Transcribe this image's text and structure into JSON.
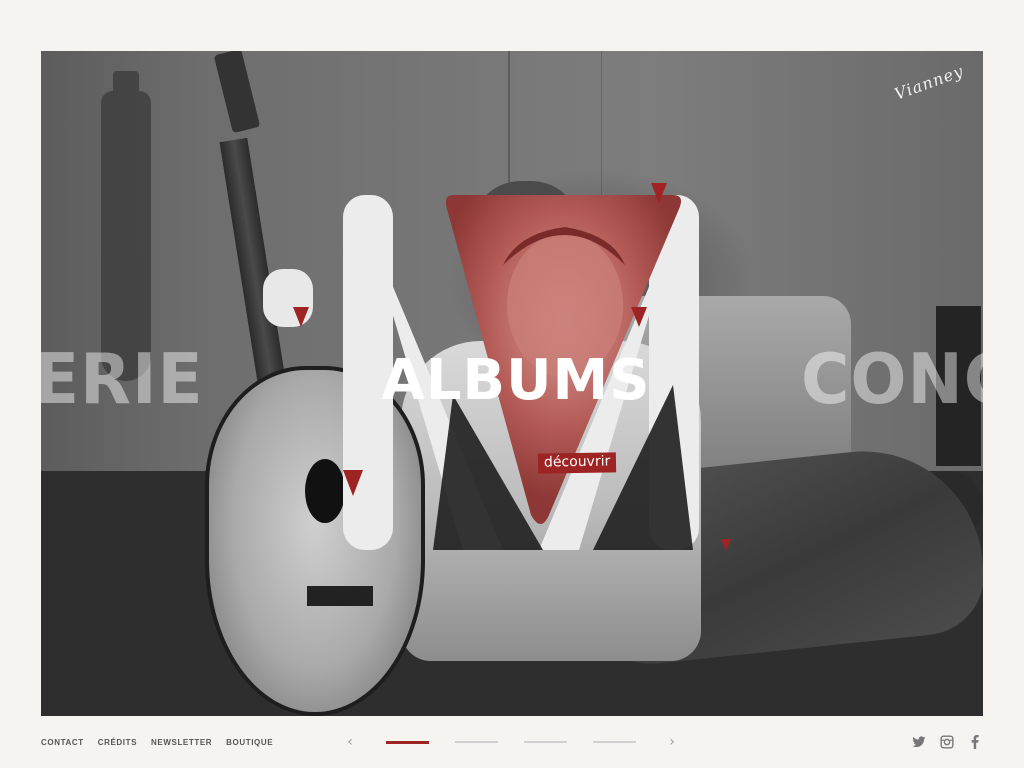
{
  "hero": {
    "signature": "Vianney",
    "title": "ALBUMS",
    "cta": "découvrir",
    "left_word": "LERIE",
    "right_word": "CONCI",
    "accent_color": "#9e2424"
  },
  "footer": {
    "links": [
      "CONTACT",
      "CRÉDITS",
      "NEWSLETTER",
      "BOUTIQUE"
    ],
    "prev_arrow": "‹",
    "next_arrow": "›",
    "pages_total": 4,
    "page_active": 1,
    "social": [
      "twitter-icon",
      "instagram-icon",
      "facebook-icon"
    ]
  }
}
